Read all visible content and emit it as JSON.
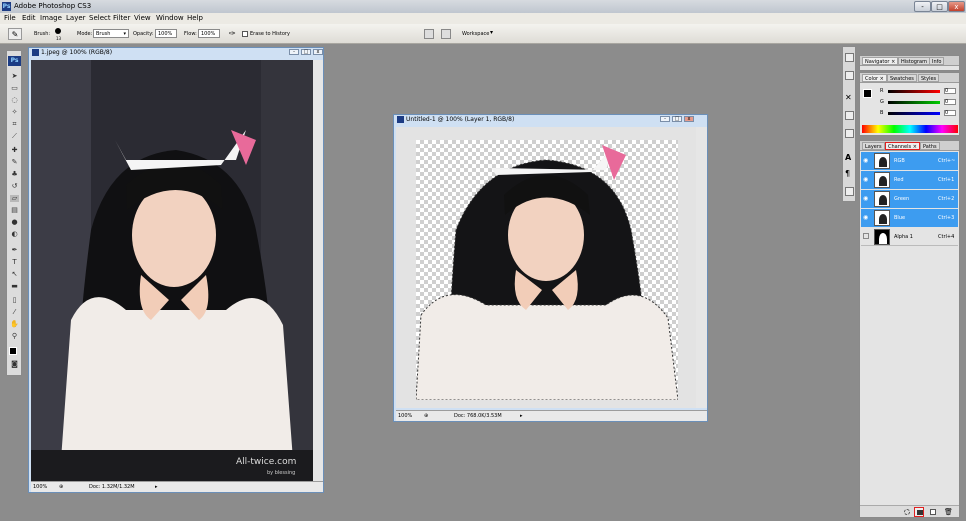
{
  "app": {
    "title": "Adobe Photoshop CS3",
    "logo": "Ps"
  },
  "window_controls": {
    "minimize": "-",
    "maximize": "□",
    "close": "x"
  },
  "menu": [
    "File",
    "Edit",
    "Image",
    "Layer",
    "Select",
    "Filter",
    "View",
    "Window",
    "Help"
  ],
  "options_bar": {
    "brush_label": "Brush:",
    "brush_size": "13",
    "mode_label": "Mode:",
    "mode_value": "Brush",
    "opacity_label": "Opacity:",
    "opacity_value": "100%",
    "flow_label": "Flow:",
    "flow_value": "100%",
    "erase_to_history": "Erase to History",
    "workspace_label": "Workspace"
  },
  "documents": [
    {
      "title": "1.jpeg @ 100% (RGB/8)",
      "zoom": "100%",
      "doc_info": "Doc: 1.32M/1.32M",
      "watermark_main": "All-twice.com",
      "watermark_sub": "by blessing"
    },
    {
      "title": "Untitled-1 @ 100% (Layer 1, RGB/8)",
      "zoom": "100%",
      "doc_info": "Doc: 768.0K/3.53M"
    }
  ],
  "panels": {
    "top_tabs": [
      "Navigator",
      "Histogram",
      "Info"
    ],
    "color_tabs": [
      "Color",
      "Swatches",
      "Styles"
    ],
    "color_channels": [
      {
        "label": "R",
        "value": "0"
      },
      {
        "label": "G",
        "value": "0"
      },
      {
        "label": "B",
        "value": "0"
      }
    ],
    "layer_tabs": [
      "Layers",
      "Channels",
      "Paths"
    ],
    "channels": [
      {
        "name": "RGB",
        "shortcut": "Ctrl+~"
      },
      {
        "name": "Red",
        "shortcut": "Ctrl+1"
      },
      {
        "name": "Green",
        "shortcut": "Ctrl+2"
      },
      {
        "name": "Blue",
        "shortcut": "Ctrl+3"
      },
      {
        "name": "Alpha 1",
        "shortcut": "Ctrl+4"
      }
    ]
  },
  "colors": {
    "accent": "#1e90ff",
    "channel_selected": "#3d9cf0",
    "highlight_box": "#e02020"
  }
}
